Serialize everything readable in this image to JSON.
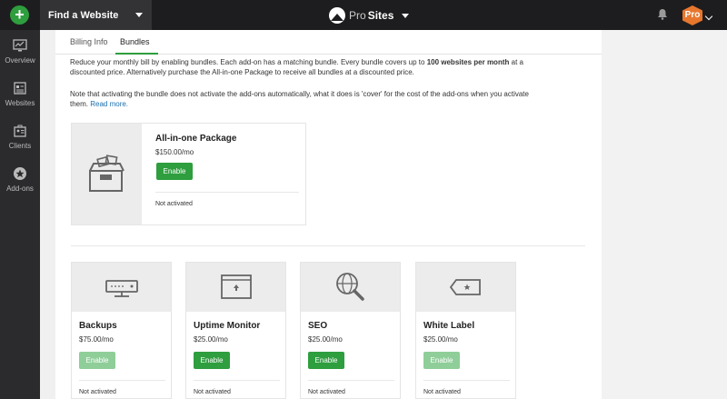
{
  "topbar": {
    "add_label": "+",
    "site_select": "Find a Website",
    "brand_pro": "Pro",
    "brand_sites": "Sites",
    "user_badge": "Pro"
  },
  "sidebar": {
    "items": [
      {
        "label": "Overview",
        "icon": "monitor-icon"
      },
      {
        "label": "Websites",
        "icon": "websites-icon"
      },
      {
        "label": "Clients",
        "icon": "clients-icon"
      },
      {
        "label": "Add-ons",
        "icon": "star-badge-icon"
      }
    ]
  },
  "tabs": [
    {
      "label": "Billing Info"
    },
    {
      "label": "Bundles",
      "active": true
    }
  ],
  "intro": {
    "before": "Reduce your monthly bill by enabling bundles. Each add-on has a matching bundle. Every bundle covers up to ",
    "strong": "100 websites per month",
    "after": " at a discounted price. Alternatively purchase the All-in-one Package to receive all bundles at a discounted price."
  },
  "note": {
    "text": "Note that activating the bundle does not activate the add-ons automatically, what it does is 'cover' for the cost of the add-ons when you activate them. ",
    "link": "Read more."
  },
  "package": {
    "title": "All-in-one Package",
    "price": "$150.00/mo",
    "button": "Enable",
    "status": "Not activated",
    "icon": "box-icon"
  },
  "addons": [
    {
      "title": "Backups",
      "price": "$75.00/mo",
      "button": "Enable",
      "enabled": false,
      "status": "Not activated",
      "icon": "server-icon"
    },
    {
      "title": "Uptime Monitor",
      "price": "$25.00/mo",
      "button": "Enable",
      "enabled": true,
      "status": "Not activated",
      "icon": "window-icon"
    },
    {
      "title": "SEO",
      "price": "$25.00/mo",
      "button": "Enable",
      "enabled": true,
      "status": "Not activated",
      "icon": "globe-search-icon"
    },
    {
      "title": "White Label",
      "price": "$25.00/mo",
      "button": "Enable",
      "enabled": false,
      "status": "Not activated",
      "icon": "tag-icon"
    }
  ],
  "colors": {
    "accent": "#2e9e3e",
    "accent_disabled": "#8fce99",
    "topbar": "#1d1d1f",
    "sidebar": "#2b2b2e",
    "badge": "#e8772e",
    "link": "#1a6fb0"
  }
}
